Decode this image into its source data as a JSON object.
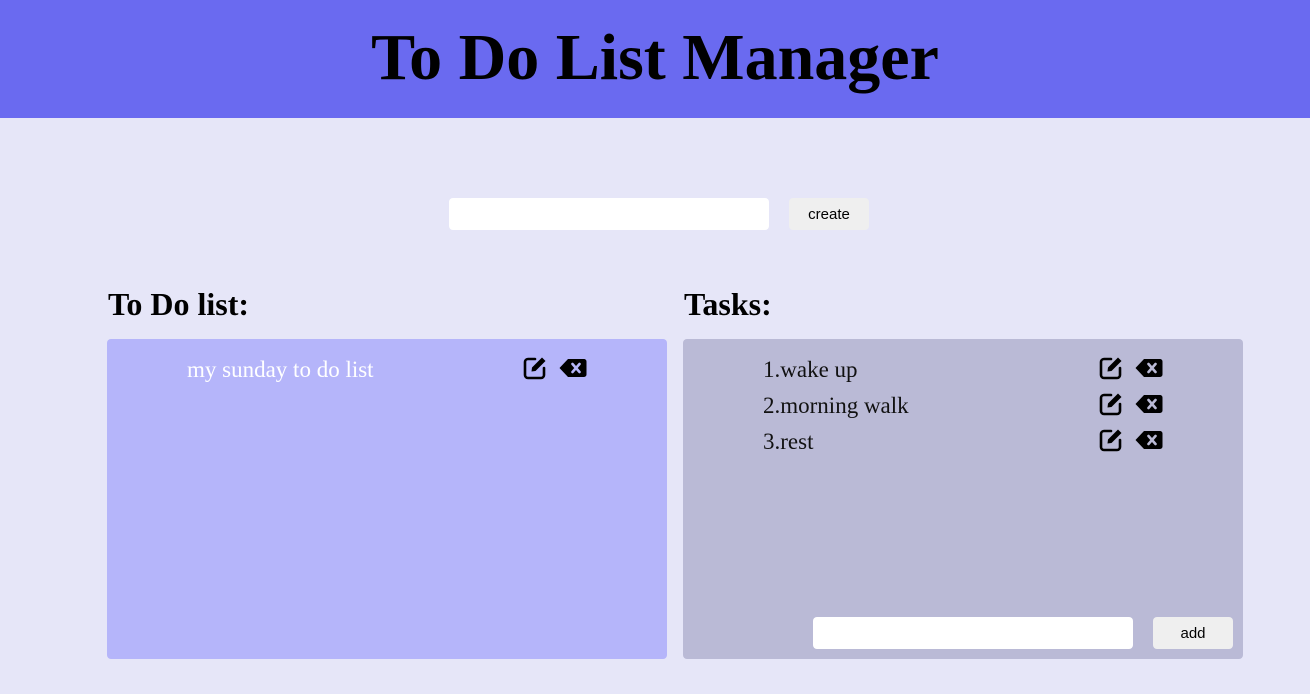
{
  "header": {
    "title": "To Do List Manager",
    "background": "#6a6af0"
  },
  "create": {
    "input_value": "",
    "input_placeholder": "",
    "button_label": "create"
  },
  "lists_section": {
    "title": "To Do list:",
    "panel_color": "#b5b5fa",
    "items": [
      {
        "label": "my sunday to do list",
        "edit_icon": "edit-icon",
        "delete_icon": "backspace-delete-icon"
      }
    ]
  },
  "tasks_section": {
    "title": "Tasks:",
    "panel_color": "#babad6",
    "items": [
      {
        "label": "1.wake up",
        "edit_icon": "edit-icon",
        "delete_icon": "backspace-delete-icon"
      },
      {
        "label": "2.morning walk",
        "edit_icon": "edit-icon",
        "delete_icon": "backspace-delete-icon"
      },
      {
        "label": "3.rest",
        "edit_icon": "edit-icon",
        "delete_icon": "backspace-delete-icon"
      }
    ],
    "add_input_value": "",
    "add_input_placeholder": "",
    "add_button_label": "add"
  },
  "colors": {
    "page_background": "#e6e6f8",
    "list_item_text": "#ffffff",
    "task_item_text": "#111111"
  }
}
